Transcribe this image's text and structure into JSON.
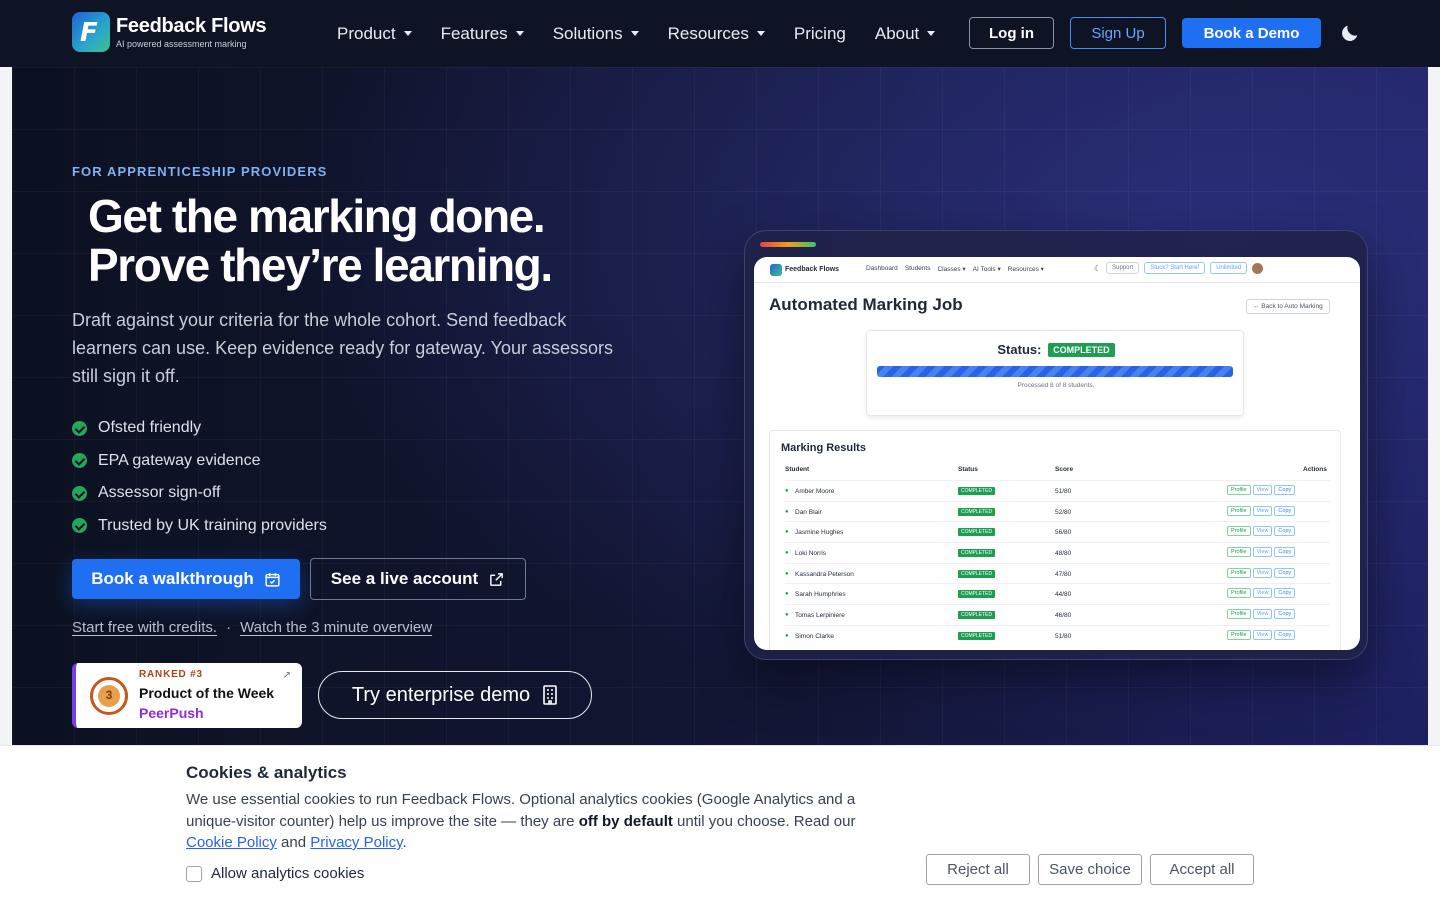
{
  "nav": {
    "brand": "Feedback Flows",
    "tagline": "AI powered assessment marking",
    "items": [
      {
        "label": "Product",
        "dropdown": true
      },
      {
        "label": "Features",
        "dropdown": true
      },
      {
        "label": "Solutions",
        "dropdown": true
      },
      {
        "label": "Resources",
        "dropdown": true
      },
      {
        "label": "Pricing",
        "dropdown": false
      },
      {
        "label": "About",
        "dropdown": true
      }
    ],
    "login": "Log in",
    "signup": "Sign Up",
    "book_demo": "Book a Demo",
    "theme_icon": "moon-icon"
  },
  "hero": {
    "eyebrow": "FOR APPRENTICESHIP PROVIDERS",
    "headline_line1": "Get the marking done.",
    "headline_line2": "Prove they’re learning.",
    "subtitle": "Draft against your criteria for the whole cohort. Send feedback learners can use. Keep evidence ready for gateway. Your assessors still sign it off.",
    "checklist": [
      "Ofsted friendly",
      "EPA gateway evidence",
      "Assessor sign-off",
      "Trusted by UK training providers"
    ],
    "primary_cta": "Book a walkthrough",
    "secondary_cta": "See a live account",
    "link_free": "Start free with credits.",
    "link_separator": "·",
    "link_overview": "Watch the 3 minute overview",
    "badge": {
      "ranked": "RANKED #3",
      "title": "Product of the Week",
      "source": "PeerPush"
    },
    "enterprise_cta": "Try enterprise demo"
  },
  "screenshot": {
    "brand": "Feedback Flows",
    "menu": [
      "Dashboard",
      "Students",
      "Classes ▾",
      "AI Tools ▾",
      "Resources ▾"
    ],
    "support": "Support",
    "stuck": "Stuck? Start Here!",
    "unlimited": "Unlimited",
    "title": "Automated Marking Job",
    "back": "← Back to Auto Marking",
    "status_label": "Status:",
    "status_value": "COMPLETED",
    "progress_pct": 100,
    "processed": "Processed 8 of 8 students.",
    "results_title": "Marking Results",
    "columns": [
      "Student",
      "Status",
      "Score",
      "Actions"
    ],
    "actions": [
      "Profile",
      "View",
      "Copy"
    ],
    "rows": [
      {
        "name": "Amber Moore",
        "status": "COMPLETED",
        "score": "51/80"
      },
      {
        "name": "Dan Blair",
        "status": "COMPLETED",
        "score": "52/80"
      },
      {
        "name": "Jasmine Hughes",
        "status": "COMPLETED",
        "score": "56/80"
      },
      {
        "name": "Loki Norris",
        "status": "COMPLETED",
        "score": "48/80"
      },
      {
        "name": "Kassandra Peterson",
        "status": "COMPLETED",
        "score": "47/80"
      },
      {
        "name": "Sarah Humphries",
        "status": "COMPLETED",
        "score": "44/80"
      },
      {
        "name": "Tomas Lerpiniere",
        "status": "COMPLETED",
        "score": "46/80"
      },
      {
        "name": "Simon Clarke",
        "status": "COMPLETED",
        "score": "51/80"
      }
    ]
  },
  "cookie": {
    "title": "Cookies & analytics",
    "body_part1": "We use essential cookies to run Feedback Flows. Optional analytics cookies (Google Analytics and a unique-visitor counter) help us improve the site — they are ",
    "body_bold": "off by default",
    "body_part2": " until you choose. Read our ",
    "cookie_policy": "Cookie Policy",
    "and": " and ",
    "privacy_policy": "Privacy Policy",
    "period": ".",
    "allow_label": "Allow analytics cookies",
    "allow_checked": false,
    "reject": "Reject all",
    "save": "Save choice",
    "accept": "Accept all"
  }
}
